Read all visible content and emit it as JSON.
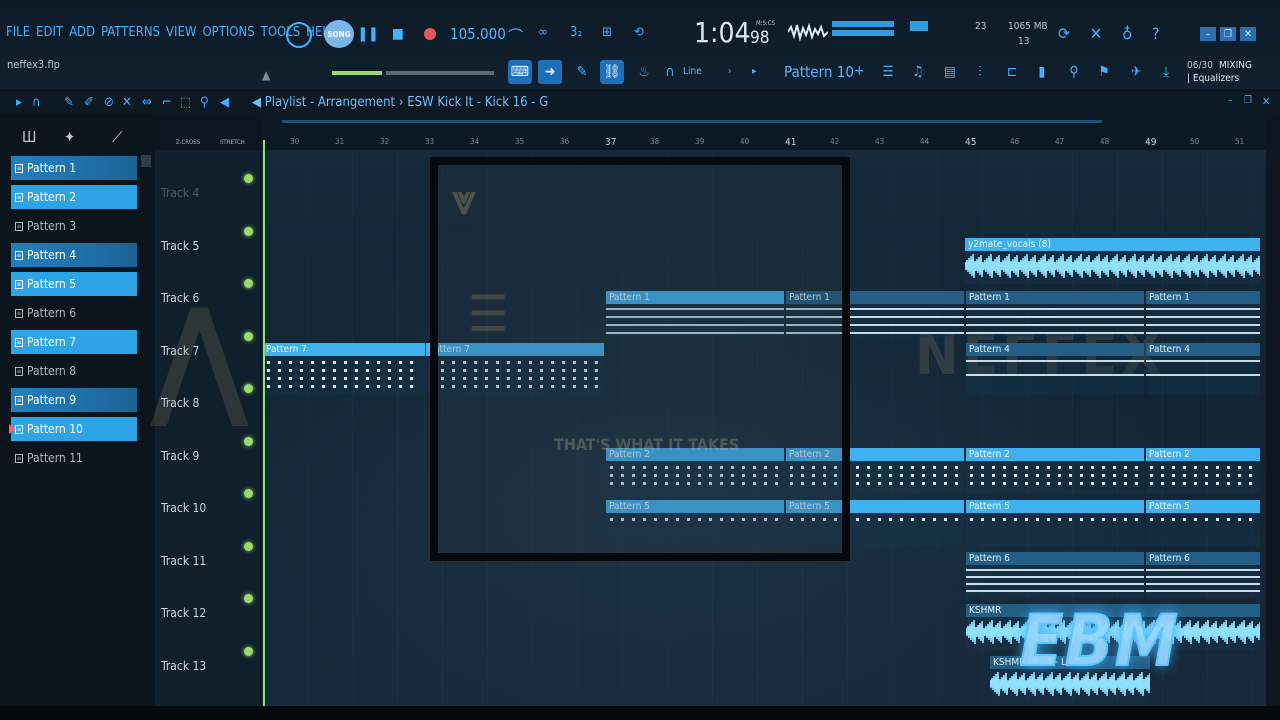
{
  "menu": [
    "FILE",
    "EDIT",
    "ADD",
    "PATTERNS",
    "VIEW",
    "OPTIONS",
    "TOOLS",
    "HELP"
  ],
  "filename": "neffex3.flp",
  "transport": {
    "mode": "SONG",
    "tempo": "105.000",
    "time_main": "1:04",
    "time_sub": "98",
    "time_label": "M:S:CS"
  },
  "stats": {
    "cpu": "23",
    "memory": "1065 MB",
    "polyphony": "13",
    "hint_count": "06/30",
    "hint_title": "MIXING",
    "hint_sub": "| Equalizers"
  },
  "toolbar2": {
    "snap_label": "Line",
    "pattern_name": "Pattern 10"
  },
  "playlist": {
    "title": "Playlist - Arrangement",
    "sep": "›",
    "clip_source": "ESW Kick It - Kick 16 - G",
    "crossfade": "Z-CROSS",
    "stretch": "STRETCH"
  },
  "patterns": [
    {
      "name": "Pattern 1",
      "state": "half"
    },
    {
      "name": "Pattern 2",
      "state": "sel"
    },
    {
      "name": "Pattern 3",
      "state": "dim"
    },
    {
      "name": "Pattern 4",
      "state": "half"
    },
    {
      "name": "Pattern 5",
      "state": "sel"
    },
    {
      "name": "Pattern 6",
      "state": "dim"
    },
    {
      "name": "Pattern 7",
      "state": "sel"
    },
    {
      "name": "Pattern 8",
      "state": "dim"
    },
    {
      "name": "Pattern 9",
      "state": "half"
    },
    {
      "name": "Pattern 10",
      "state": "sel"
    },
    {
      "name": "Pattern 11",
      "state": "dim"
    }
  ],
  "tracks": [
    "Track 4",
    "Track 5",
    "Track 6",
    "Track 7",
    "Track 8",
    "Track 9",
    "Track 10",
    "Track 11",
    "Track 12",
    "Track 13"
  ],
  "ruler": [
    "30",
    "31",
    "32",
    "33",
    "34",
    "35",
    "36",
    "37",
    "38",
    "39",
    "40",
    "41",
    "42",
    "43",
    "44",
    "45",
    "46",
    "47",
    "48",
    "49",
    "50",
    "51"
  ],
  "clips": {
    "vocals": "y2mate_vocals (8)",
    "p1": "Pattern 1",
    "p2": "Pattern 2",
    "p4": "Pattern 4",
    "p5": "Pattern 5",
    "p6": "Pattern 6",
    "p7": "Pattern 7",
    "kshmr": "KSHMR",
    "kshmr2": "KSHMR Or...II - L"
  },
  "overlay": {
    "logo_text": "EBM",
    "wm1": "NEFFEX",
    "wm2": "THAT'S WHAT IT TAKES"
  },
  "colors": {
    "accent": "#3fb1ff",
    "clip": "#3fb1ef",
    "led": "#9bd96a",
    "flag": "#ff5f5f"
  }
}
